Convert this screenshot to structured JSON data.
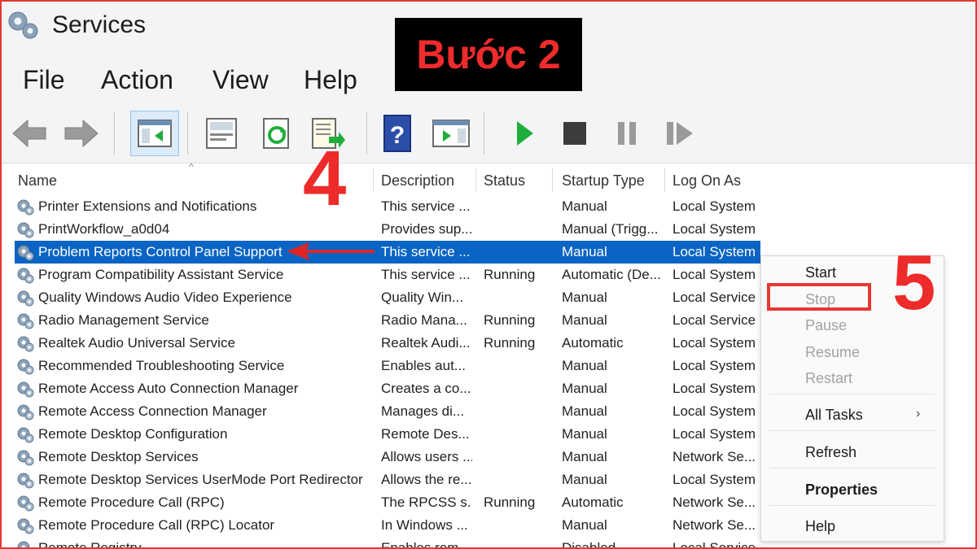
{
  "window": {
    "title": "Services"
  },
  "menu": [
    "File",
    "Action",
    "View",
    "Help"
  ],
  "step_label": "Bước 2",
  "annotations": {
    "step4": "4",
    "step5": "5"
  },
  "toolbar": {
    "icons": [
      "back-arrow-icon",
      "forward-arrow-icon",
      "show-hide-console-tree-icon",
      "properties-icon",
      "refresh-icon",
      "export-list-icon",
      "help-icon",
      "show-hide-action-pane-icon",
      "start-service-icon",
      "stop-service-icon",
      "pause-service-icon",
      "restart-service-icon"
    ]
  },
  "columns": {
    "name": "Name",
    "description": "Description",
    "status": "Status",
    "startup": "Startup Type",
    "logon": "Log On As"
  },
  "rows": [
    {
      "name": "Printer Extensions and Notifications",
      "description": "This service ...",
      "status": "",
      "startup": "Manual",
      "logon": "Local System"
    },
    {
      "name": "PrintWorkflow_a0d04",
      "description": "Provides sup...",
      "status": "",
      "startup": "Manual (Trigg...",
      "logon": "Local System"
    },
    {
      "name": "Problem Reports Control Panel Support",
      "description": "This service ...",
      "status": "",
      "startup": "Manual",
      "logon": "Local System"
    },
    {
      "name": "Program Compatibility Assistant Service",
      "description": "This service ...",
      "status": "Running",
      "startup": "Automatic (De...",
      "logon": "Local System"
    },
    {
      "name": "Quality Windows Audio Video Experience",
      "description": "Quality Win...",
      "status": "",
      "startup": "Manual",
      "logon": "Local Service"
    },
    {
      "name": "Radio Management Service",
      "description": "Radio Mana...",
      "status": "Running",
      "startup": "Manual",
      "logon": "Local Service"
    },
    {
      "name": "Realtek Audio Universal Service",
      "description": "Realtek Audi...",
      "status": "Running",
      "startup": "Automatic",
      "logon": "Local System"
    },
    {
      "name": "Recommended Troubleshooting Service",
      "description": "Enables aut...",
      "status": "",
      "startup": "Manual",
      "logon": "Local System"
    },
    {
      "name": "Remote Access Auto Connection Manager",
      "description": "Creates a co...",
      "status": "",
      "startup": "Manual",
      "logon": "Local System"
    },
    {
      "name": "Remote Access Connection Manager",
      "description": "Manages di...",
      "status": "",
      "startup": "Manual",
      "logon": "Local System"
    },
    {
      "name": "Remote Desktop Configuration",
      "description": "Remote Des...",
      "status": "",
      "startup": "Manual",
      "logon": "Local System"
    },
    {
      "name": "Remote Desktop Services",
      "description": "Allows users ...",
      "status": "",
      "startup": "Manual",
      "logon": "Network Se..."
    },
    {
      "name": "Remote Desktop Services UserMode Port Redirector",
      "description": "Allows the re...",
      "status": "",
      "startup": "Manual",
      "logon": "Local System"
    },
    {
      "name": "Remote Procedure Call (RPC)",
      "description": "The RPCSS s...",
      "status": "Running",
      "startup": "Automatic",
      "logon": "Network Se..."
    },
    {
      "name": "Remote Procedure Call (RPC) Locator",
      "description": "In Windows ...",
      "status": "",
      "startup": "Manual",
      "logon": "Network Se..."
    },
    {
      "name": "Remote Registry",
      "description": "Enables rem...",
      "status": "",
      "startup": "Disabled",
      "logon": "Local Service"
    }
  ],
  "context_menu": {
    "start": "Start",
    "stop": "Stop",
    "pause": "Pause",
    "resume": "Resume",
    "restart": "Restart",
    "all_tasks": "All Tasks",
    "refresh": "Refresh",
    "properties": "Properties",
    "help": "Help"
  },
  "colors": {
    "selection": "#0a64c4",
    "annotation": "#ee2b2b",
    "start_green": "#1fae3b"
  }
}
